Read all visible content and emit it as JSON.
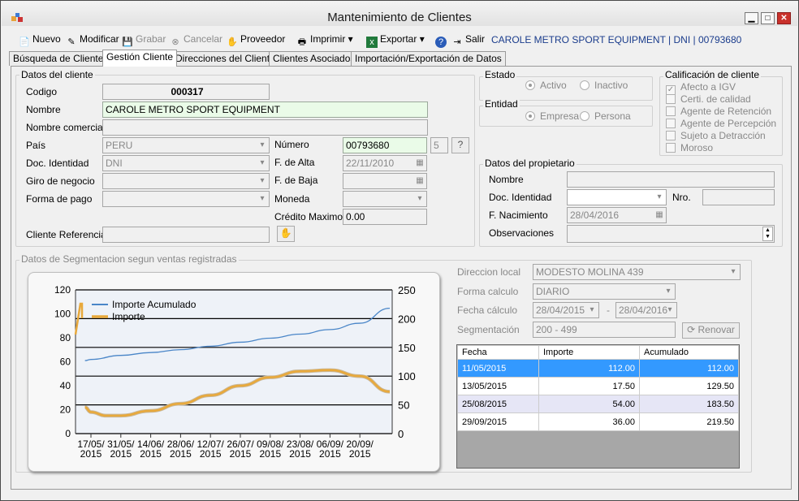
{
  "window": {
    "title": "Mantenimiento de  Clientes"
  },
  "toolbar": {
    "nuevo": "Nuevo",
    "modificar": "Modificar",
    "grabar": "Grabar",
    "cancelar": "Cancelar",
    "proveedor": "Proveedor",
    "imprimir": "Imprimir",
    "exportar": "Exportar",
    "salir": "Salir",
    "customer_info": "CAROLE METRO SPORT EQUIPMENT | DNI | 00793680"
  },
  "tabs": [
    "Búsqueda de Clientes",
    "Gestión Cliente",
    "Direcciones del Cliente",
    "Clientes Asociados",
    "Importación/Exportación de Datos"
  ],
  "datos": {
    "group": "Datos del cliente",
    "codigo_label": "Codigo",
    "codigo": "000317",
    "nombre_label": "Nombre",
    "nombre": "CAROLE METRO SPORT EQUIPMENT",
    "comercial_label": "Nombre comercial",
    "comercial": "",
    "pais_label": "País",
    "pais": "PERU",
    "doc_label": "Doc. Identidad",
    "doc": "DNI",
    "giro_label": "Giro de negocio",
    "giro": "",
    "forma_label": "Forma de pago",
    "forma": "",
    "numero_label": "Número",
    "numero": "00793680",
    "numero_len": "5",
    "alta_label": "F. de Alta",
    "alta": "22/11/2010",
    "baja_label": "F. de Baja",
    "baja": "",
    "moneda_label": "Moneda",
    "moneda": "",
    "credito_label": "Crédito Maximo",
    "credito": "0.00",
    "ref_label": "Cliente Referencia",
    "ref": ""
  },
  "estado": {
    "group": "Estado",
    "activo": "Activo",
    "inactivo": "Inactivo"
  },
  "entidad": {
    "group": "Entidad",
    "empresa": "Empresa",
    "persona": "Persona"
  },
  "calificacion": {
    "group": "Calificación de cliente",
    "items": [
      "Afecto a IGV",
      "Certi. de calidad",
      "Agente de Retención",
      "Agente de Percepción",
      "Sujeto a Detracción",
      "Moroso"
    ],
    "checked": [
      true,
      false,
      false,
      false,
      false,
      false
    ]
  },
  "propietario": {
    "group": "Datos del propietario",
    "nombre_label": "Nombre",
    "doc_label": "Doc. Identidad",
    "nro_label": "Nro.",
    "nac_label": "F. Nacimiento",
    "nac": "28/04/2016",
    "obs_label": "Observaciones"
  },
  "segmentacion": {
    "group": "Datos de Segmentacion segun ventas registradas",
    "dir_label": "Direccion local",
    "dir": "MODESTO MOLINA 439",
    "forma_label": "Forma calculo",
    "forma": "DIARIO",
    "fecha_label": "Fecha cálculo",
    "fecha_desde": "28/04/2015",
    "sep": "-",
    "fecha_hasta": "28/04/2016",
    "seg_label": "Segmentación",
    "seg": "200 - 499",
    "renovar": "Renovar"
  },
  "table": {
    "headers": [
      "Fecha",
      "Importe",
      "Acumulado"
    ],
    "rows": [
      [
        "11/05/2015",
        "112.00",
        "112.00"
      ],
      [
        "13/05/2015",
        "17.50",
        "129.50"
      ],
      [
        "25/08/2015",
        "54.00",
        "183.50"
      ],
      [
        "29/09/2015",
        "36.00",
        "219.50"
      ]
    ]
  },
  "chart_data": {
    "type": "line",
    "legend": [
      "Importe Acumulado",
      "Importe"
    ],
    "legend_position": "top-left",
    "x_ticks": [
      "17/05/\n2015",
      "31/05/\n2015",
      "14/06/\n2015",
      "28/06/\n2015",
      "12/07/\n2015",
      "26/07/\n2015",
      "09/08/\n2015",
      "23/08/\n2015",
      "06/09/\n2015",
      "20/09/\n2015"
    ],
    "y_left": {
      "ticks": [
        0,
        20,
        40,
        60,
        80,
        100,
        120
      ],
      "ylim": [
        0,
        120
      ]
    },
    "y_right": {
      "ticks": [
        0,
        50,
        100,
        150,
        200,
        250
      ],
      "ylim": [
        0,
        250
      ]
    },
    "series": [
      {
        "name": "Importe Acumulado",
        "axis": "right",
        "color": "#4a86c8",
        "x_index": [
          -0.2,
          0,
          1,
          2,
          3,
          4,
          5,
          6,
          7,
          8,
          9,
          10
        ],
        "values": [
          127,
          129,
          136,
          141,
          146,
          152,
          159,
          166,
          173,
          181,
          192,
          218
        ]
      },
      {
        "name": "Importe",
        "axis": "left",
        "color": "#e8a93c",
        "x_index": [
          -0.2,
          0,
          0.5,
          1,
          2,
          3,
          4,
          5,
          6,
          7,
          8,
          9,
          10
        ],
        "values": [
          22,
          18,
          15,
          15,
          19,
          25,
          32,
          40,
          47,
          52,
          53,
          48,
          35
        ]
      }
    ],
    "colors": {
      "accumulated": "#4a86c8",
      "importe": "#e8a93c"
    }
  }
}
